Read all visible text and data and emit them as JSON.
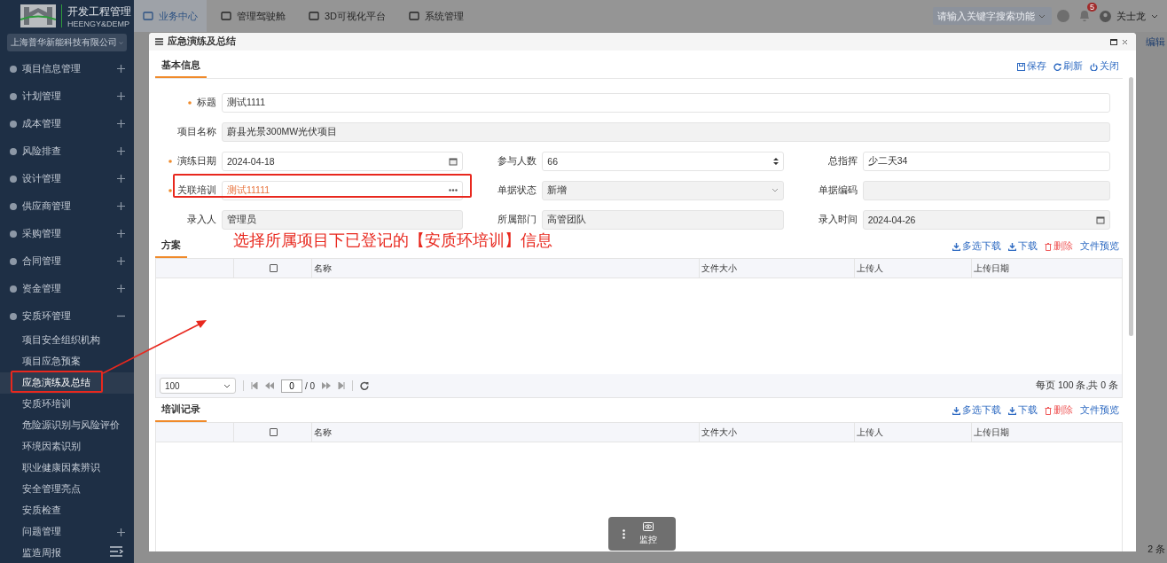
{
  "logo": {
    "title": "开发工程管理",
    "subtitle": "HEENGY&DEMP"
  },
  "company_select": {
    "value": "上海普华新能科技有限公司"
  },
  "sidebar": {
    "items": [
      {
        "label": "项目信息管理",
        "expanded": false
      },
      {
        "label": "计划管理",
        "expanded": false
      },
      {
        "label": "成本管理",
        "expanded": false
      },
      {
        "label": "风险排查",
        "expanded": false
      },
      {
        "label": "设计管理",
        "expanded": false
      },
      {
        "label": "供应商管理",
        "expanded": false
      },
      {
        "label": "采购管理",
        "expanded": false
      },
      {
        "label": "合同管理",
        "expanded": false
      },
      {
        "label": "资金管理",
        "expanded": false
      },
      {
        "label": "安质环管理",
        "expanded": true,
        "children": [
          {
            "label": "项目安全组织机构",
            "selected": false,
            "expandable": false
          },
          {
            "label": "项目应急预案",
            "selected": false,
            "expandable": false
          },
          {
            "label": "应急演练及总结",
            "selected": true,
            "expandable": false
          },
          {
            "label": "安质环培训",
            "selected": false,
            "expandable": false
          },
          {
            "label": "危险源识别与风险评价",
            "selected": false,
            "expandable": false
          },
          {
            "label": "环境因素识别",
            "selected": false,
            "expandable": false
          },
          {
            "label": "职业健康因素辨识",
            "selected": false,
            "expandable": false
          },
          {
            "label": "安全管理亮点",
            "selected": false,
            "expandable": false
          },
          {
            "label": "安质检查",
            "selected": false,
            "expandable": false
          },
          {
            "label": "问题管理",
            "selected": false,
            "expandable": true
          },
          {
            "label": "监造周报",
            "selected": false,
            "expandable": false
          }
        ]
      }
    ]
  },
  "top_nav": {
    "tabs": [
      {
        "label": "业务中心",
        "selected": true
      },
      {
        "label": "管理驾驶舱",
        "selected": false
      },
      {
        "label": "3D可视化平台",
        "selected": false
      },
      {
        "label": "系统管理",
        "selected": false
      }
    ]
  },
  "search": {
    "placeholder": "请输入关键字搜索功能"
  },
  "notifications": {
    "count": "5"
  },
  "user": {
    "name": "关士龙"
  },
  "background": {
    "link": "编辑",
    "footer": "2 条"
  },
  "modal": {
    "title": "应急演练及总结",
    "tab": "基本信息",
    "actions": [
      {
        "label": "保存",
        "kind": "save"
      },
      {
        "label": "刷新",
        "kind": "refresh"
      },
      {
        "label": "关闭",
        "kind": "close"
      }
    ],
    "rows": [
      [
        {
          "label": "标题",
          "value": "测试1111",
          "required": true,
          "disabled": false,
          "kind": "text"
        }
      ],
      [
        {
          "label": "项目名称",
          "value": "蔚县光景300MW光伏项目",
          "required": false,
          "disabled": true,
          "kind": "text"
        }
      ],
      [
        {
          "label": "演练日期",
          "value": "2024-04-18",
          "required": true,
          "disabled": false,
          "kind": "date"
        },
        {
          "label": "参与人数",
          "value": "66",
          "required": false,
          "disabled": false,
          "kind": "number"
        },
        {
          "label": "总指挥",
          "value": "少二天34",
          "required": false,
          "disabled": false,
          "kind": "text"
        }
      ],
      [
        {
          "label": "关联培训",
          "value": "测试11111",
          "required": true,
          "disabled": false,
          "kind": "lookup"
        },
        {
          "label": "单据状态",
          "value": "新增",
          "required": false,
          "disabled": true,
          "kind": "select"
        },
        {
          "label": "单据编码",
          "required": false,
          "disabled": true,
          "kind": "text"
        }
      ],
      [
        {
          "label": "录入人",
          "value": "管理员",
          "required": false,
          "disabled": true,
          "kind": "text"
        },
        {
          "label": "所属部门",
          "value": "高管团队",
          "required": false,
          "disabled": true,
          "kind": "text"
        },
        {
          "label": "录入时间",
          "value": "2024-04-26",
          "required": false,
          "disabled": true,
          "kind": "date"
        }
      ]
    ],
    "sections": [
      {
        "title": "方案",
        "select_all": {
          "checked": false
        },
        "columns": [
          "名称",
          "文件大小",
          "上传人",
          "上传日期"
        ],
        "toolbar": [
          {
            "label": "多选下载",
            "kind": "download"
          },
          {
            "label": "下载",
            "kind": "download"
          },
          {
            "label": "删除",
            "kind": "delete"
          },
          {
            "label": "文件预览",
            "kind": "preview"
          }
        ],
        "pager": {
          "page_size": "100",
          "page": "0",
          "total_pages": "/ 0",
          "summary": "每页 100 条,共 0 条"
        }
      },
      {
        "title": "培训记录",
        "select_all": {
          "checked": false
        },
        "columns": [
          "名称",
          "文件大小",
          "上传人",
          "上传日期"
        ],
        "toolbar": [
          {
            "label": "多选下载",
            "kind": "download"
          },
          {
            "label": "下载",
            "kind": "download"
          },
          {
            "label": "删除",
            "kind": "delete"
          },
          {
            "label": "文件预览",
            "kind": "preview"
          }
        ]
      }
    ]
  },
  "annotation": {
    "note": "选择所属项目下已登记的【安质环培训】信息"
  },
  "floating_widget": {
    "label": "监控"
  }
}
